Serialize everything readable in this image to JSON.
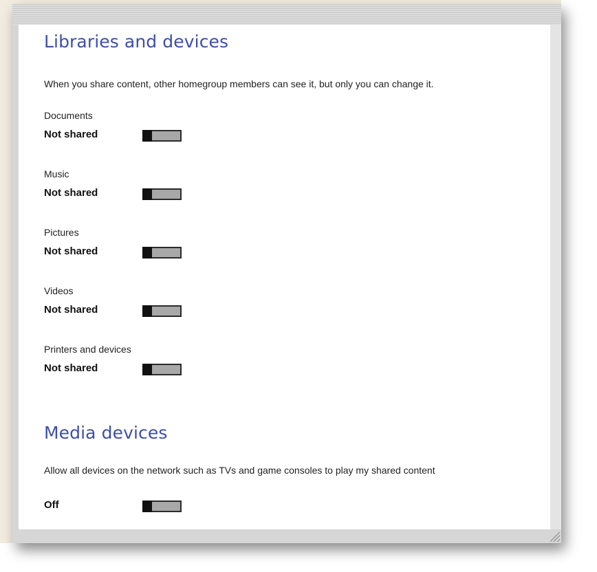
{
  "libraries": {
    "title": "Libraries and devices",
    "description": "When you share content, other homegroup members can see it, but only you can change it.",
    "items": [
      {
        "label": "Documents",
        "state": "Not shared",
        "on": false
      },
      {
        "label": "Music",
        "state": "Not shared",
        "on": false
      },
      {
        "label": "Pictures",
        "state": "Not shared",
        "on": false
      },
      {
        "label": "Videos",
        "state": "Not shared",
        "on": false
      },
      {
        "label": "Printers and devices",
        "state": "Not shared",
        "on": false
      }
    ]
  },
  "media": {
    "title": "Media devices",
    "description": "Allow all devices on the network such as TVs and game consoles to play my shared content",
    "state": "Off",
    "on": false
  }
}
